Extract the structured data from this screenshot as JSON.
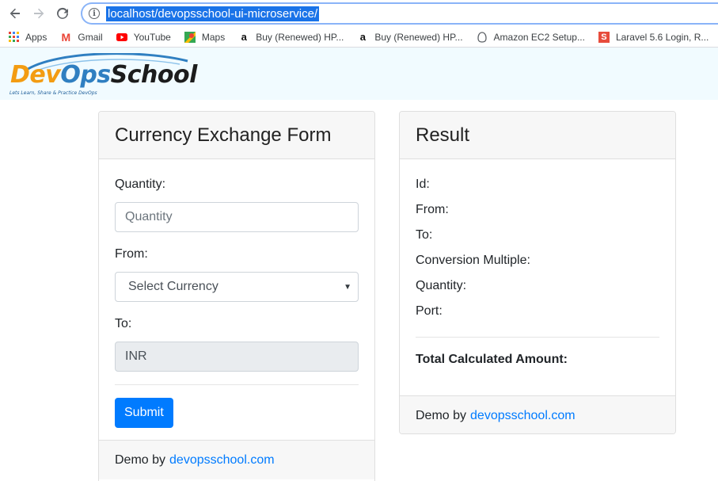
{
  "browser": {
    "url": "localhost/devopsschool-ui-microservice/",
    "bookmarks": [
      {
        "label": "Apps",
        "icon": "apps-icon"
      },
      {
        "label": "Gmail",
        "icon": "gmail-icon"
      },
      {
        "label": "YouTube",
        "icon": "youtube-icon"
      },
      {
        "label": "Maps",
        "icon": "maps-icon"
      },
      {
        "label": "Buy (Renewed) HP...",
        "icon": "amazon-icon"
      },
      {
        "label": "Buy (Renewed) HP...",
        "icon": "amazon-icon"
      },
      {
        "label": "Amazon EC2 Setup...",
        "icon": "page-icon"
      },
      {
        "label": "Laravel 5.6 Login, R...",
        "icon": "slides-icon"
      }
    ]
  },
  "logo": {
    "part1": "Dev",
    "part2": "Ops",
    "part3": "School",
    "tagline": "Lets Learn, Share & Practice DevOps"
  },
  "form": {
    "title": "Currency Exchange Form",
    "quantity_label": "Quantity:",
    "quantity_placeholder": "Quantity",
    "from_label": "From:",
    "from_selected": "Select Currency",
    "to_label": "To:",
    "to_value": "INR",
    "submit_label": "Submit",
    "footer_text": "Demo by",
    "footer_link": "devopsschool.com"
  },
  "result": {
    "title": "Result",
    "id_label": "Id:",
    "from_label": "From:",
    "to_label": "To:",
    "conversion_label": "Conversion Multiple:",
    "quantity_label": "Quantity:",
    "port_label": "Port:",
    "total_label": "Total Calculated Amount:",
    "footer_text": "Demo by",
    "footer_link": "devopsschool.com"
  },
  "colors": {
    "primary": "#007bff",
    "header_bg": "#f1fbff",
    "logo_orange": "#f39c12",
    "logo_blue": "#2f7fc1"
  }
}
